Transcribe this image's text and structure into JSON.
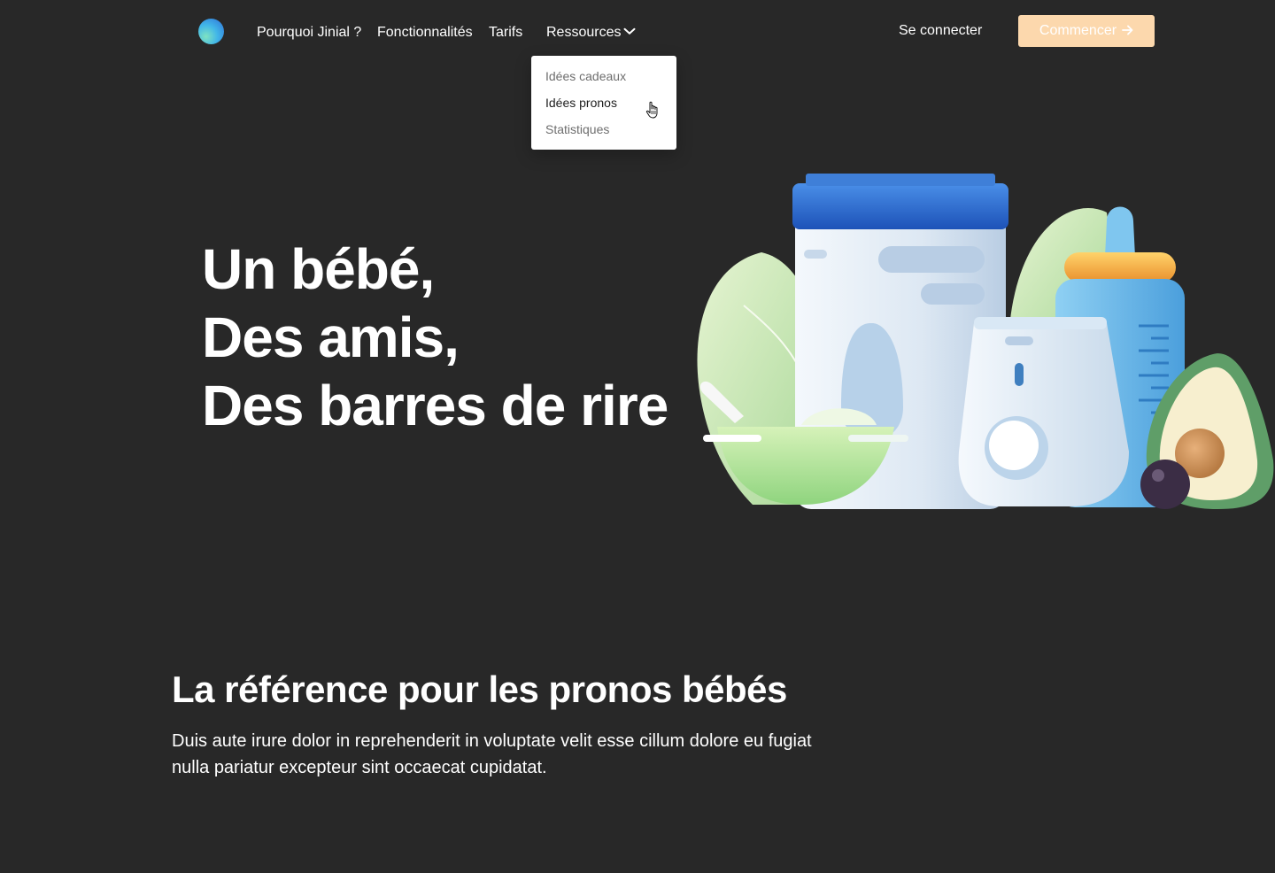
{
  "nav": {
    "links": [
      {
        "label": "Pourquoi Jinial ?"
      },
      {
        "label": "Fonctionnalités"
      },
      {
        "label": "Tarifs"
      },
      {
        "label": "Ressources"
      }
    ],
    "login_label": "Se connecter",
    "cta_label": "Commencer",
    "cta_icon": "arrow-right-icon",
    "brand_gradient": [
      "#7fe3c2",
      "#41b6e8",
      "#2f6fd8"
    ],
    "cta_color": "#fcd8ad"
  },
  "dropdown": {
    "items": [
      {
        "label": "Idées cadeaux"
      },
      {
        "label": "Idées pronos",
        "hovered": true
      },
      {
        "label": "Statistiques"
      }
    ]
  },
  "hero": {
    "lines": [
      "Un bébé,",
      "Des amis,",
      "Des barres de rire"
    ]
  },
  "section": {
    "title": "La référence pour les pronos bébés",
    "text": "Duis aute irure dolor in reprehenderit in voluptate velit esse cillum dolore eu fugiat nulla pariatur excepteur sint occaecat cupidatat."
  },
  "colors": {
    "background": "#282828",
    "text": "#ffffff"
  }
}
